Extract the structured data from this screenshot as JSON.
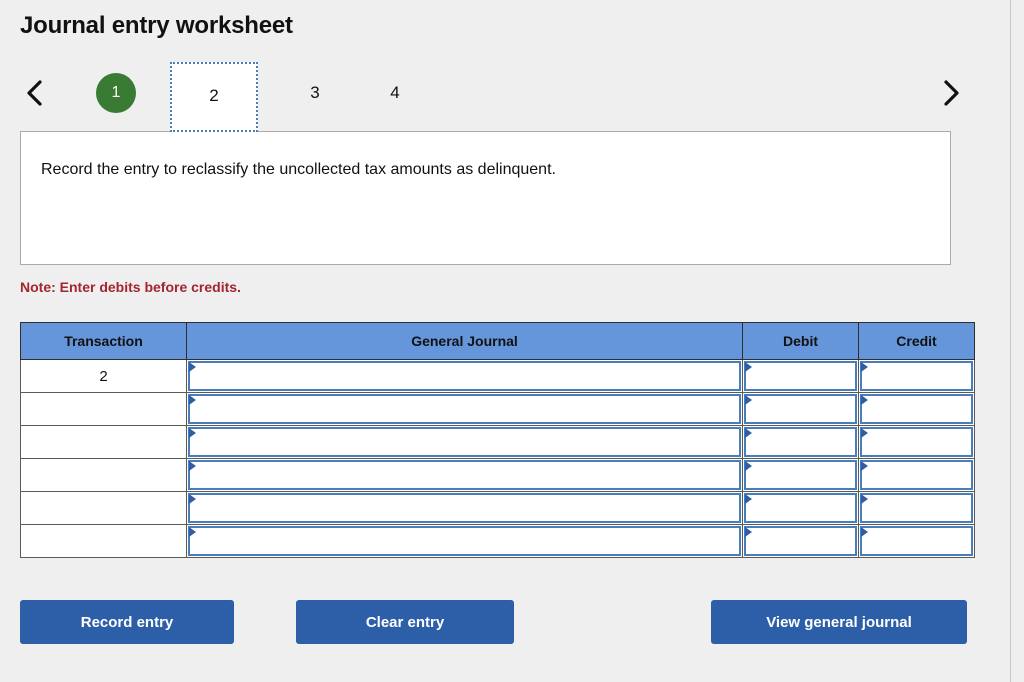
{
  "page": {
    "title": "Journal entry worksheet",
    "background_color": "#efefef"
  },
  "nav": {
    "prev_icon": "chevron-left-icon",
    "next_icon": "chevron-right-icon"
  },
  "tabs": [
    {
      "label": "1",
      "state": "completed",
      "style": "green-circle-badge",
      "color": "#3a7b33"
    },
    {
      "label": "2",
      "state": "selected",
      "style": "white-box-dotted-focus",
      "color": "#4a7ebb"
    },
    {
      "label": "3",
      "state": "normal",
      "style": "plain",
      "color": "#111111"
    },
    {
      "label": "4",
      "state": "normal",
      "style": "plain",
      "color": "#111111"
    }
  ],
  "description": {
    "text": "Record the entry to reclassify the uncollected tax amounts as delinquent."
  },
  "note": {
    "text": "Note: Enter debits before credits.",
    "color": "#a32530"
  },
  "table": {
    "header_color": "#6596db",
    "columns": [
      "Transaction",
      "General Journal",
      "Debit",
      "Credit"
    ],
    "rows": [
      {
        "transaction": "2",
        "general_journal": "",
        "debit": "",
        "credit": ""
      },
      {
        "transaction": "",
        "general_journal": "",
        "debit": "",
        "credit": ""
      },
      {
        "transaction": "",
        "general_journal": "",
        "debit": "",
        "credit": ""
      },
      {
        "transaction": "",
        "general_journal": "",
        "debit": "",
        "credit": ""
      },
      {
        "transaction": "",
        "general_journal": "",
        "debit": "",
        "credit": ""
      },
      {
        "transaction": "",
        "general_journal": "",
        "debit": "",
        "credit": ""
      }
    ]
  },
  "buttons": {
    "record": "Record entry",
    "clear": "Clear entry",
    "view": "View general journal",
    "color": "#2d5fa8"
  }
}
